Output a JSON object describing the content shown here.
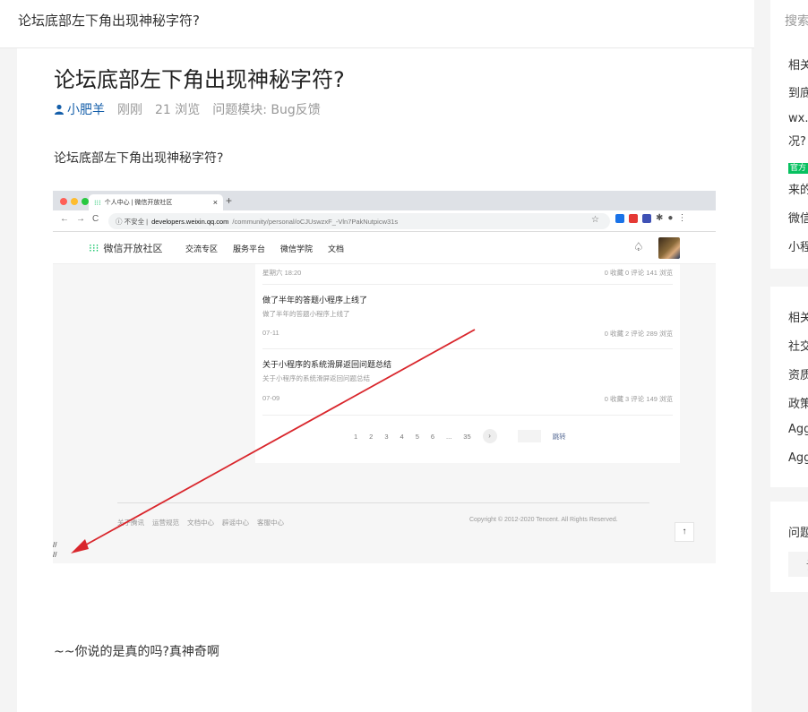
{
  "topbar": {
    "title": "论坛底部左下角出现神秘字符?"
  },
  "question": {
    "title": "论坛底部左下角出现神秘字符?",
    "author": "小肥羊",
    "time": "刚刚",
    "views": "21 浏览",
    "module": "问题模块:  Bug反馈",
    "body": "论坛底部左下角出现神秘字符?",
    "footer": "~~你说的是真的吗?真神奇啊"
  },
  "screenshot": {
    "tab_title": "个人中心 | 微信开放社区",
    "tab_close": "×",
    "new_tab": "+",
    "nav_back": "←",
    "nav_forward": "→",
    "nav_reload": "C",
    "insecure": "ⓘ 不安全 |",
    "url_host": "developers.weixin.qq.com",
    "url_path": "/community/personal/oCJUswzxF_-Vln7PakNutpicw31s",
    "star": "☆",
    "menu": "⋮",
    "logo_text": "微信开放社区",
    "nav": [
      "交流专区",
      "服务平台",
      "微信学院",
      "文档"
    ],
    "bell": "♤",
    "first_date": "星期六 18:20",
    "first_stats": "0 收藏  0 评论  141 浏览",
    "posts": [
      {
        "title": "做了半年的答题小程序上线了",
        "sub": "做了半年的答题小程序上线了",
        "date": "07-11",
        "stats": "0 收藏  2 评论  289 浏览"
      },
      {
        "title": "关于小程序的系统滑屏返回问题总结",
        "sub": "关于小程序的系统滑屏返回问题总结",
        "date": "07-09",
        "stats": "0 收藏  3 评论  149 浏览"
      }
    ],
    "pager": [
      "1",
      "2",
      "3",
      "4",
      "5",
      "6",
      "...",
      "35"
    ],
    "pager_next": "›",
    "pager_jump": "跳转",
    "footer_links": [
      "关于腾讯",
      "运营规范",
      "文档中心",
      "辟谣中心",
      "客服中心"
    ],
    "copyright": "Copyright © 2012-2020 Tencent. All Rights Reserved.",
    "totop": "↑",
    "slash1": "//",
    "slash2": "//",
    "arrow_color": "#d9262c"
  },
  "sidebar": {
    "search_placeholder": "搜索",
    "box1": [
      "相关",
      "到底",
      "wx.",
      "况?",
      "官方",
      "来的",
      "微信",
      "小程"
    ],
    "box2": [
      "相关",
      "社交",
      "资质",
      "政策",
      "Agg",
      "Agg"
    ],
    "box3_title": "问题",
    "box3_btn": "设"
  },
  "colors": {
    "link": "#155faa",
    "wechat_green": "#07c160"
  }
}
